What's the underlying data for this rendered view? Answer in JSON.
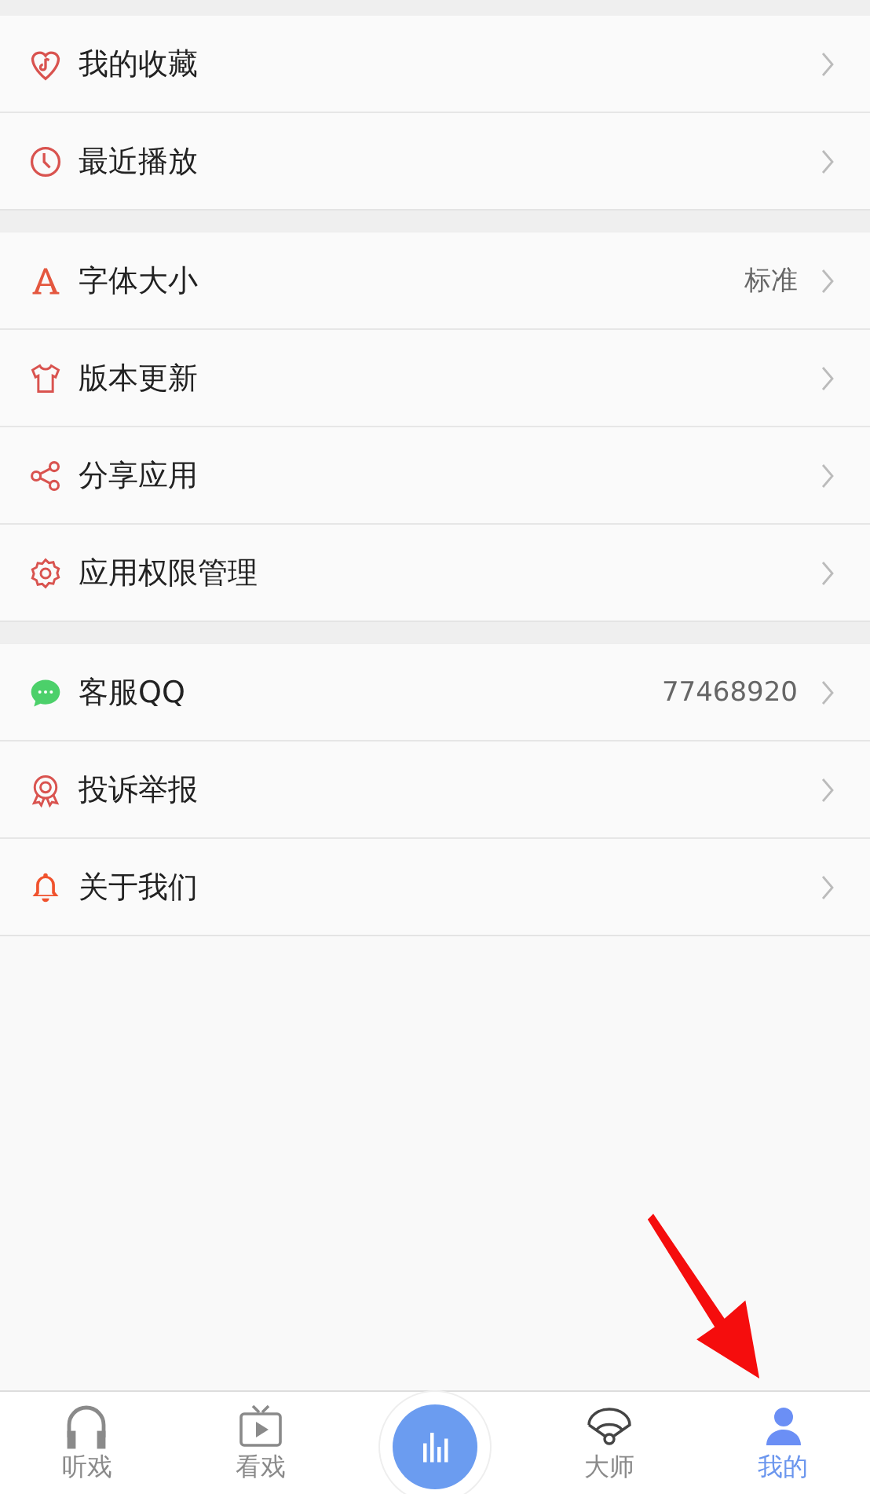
{
  "sections": [
    {
      "items": [
        {
          "label": "我的收藏"
        },
        {
          "label": "最近播放"
        }
      ]
    },
    {
      "items": [
        {
          "label": "字体大小",
          "value": "标准"
        },
        {
          "label": "版本更新"
        },
        {
          "label": "分享应用"
        },
        {
          "label": "应用权限管理"
        }
      ]
    },
    {
      "items": [
        {
          "label": "客服QQ",
          "value": "77468920"
        },
        {
          "label": "投诉举报"
        },
        {
          "label": "关于我们"
        }
      ]
    }
  ],
  "tabs": [
    {
      "label": "听戏",
      "selected": false
    },
    {
      "label": "看戏",
      "selected": false
    },
    {
      "kind": "center"
    },
    {
      "label": "大师",
      "selected": false
    },
    {
      "label": "我的",
      "selected": true
    }
  ]
}
